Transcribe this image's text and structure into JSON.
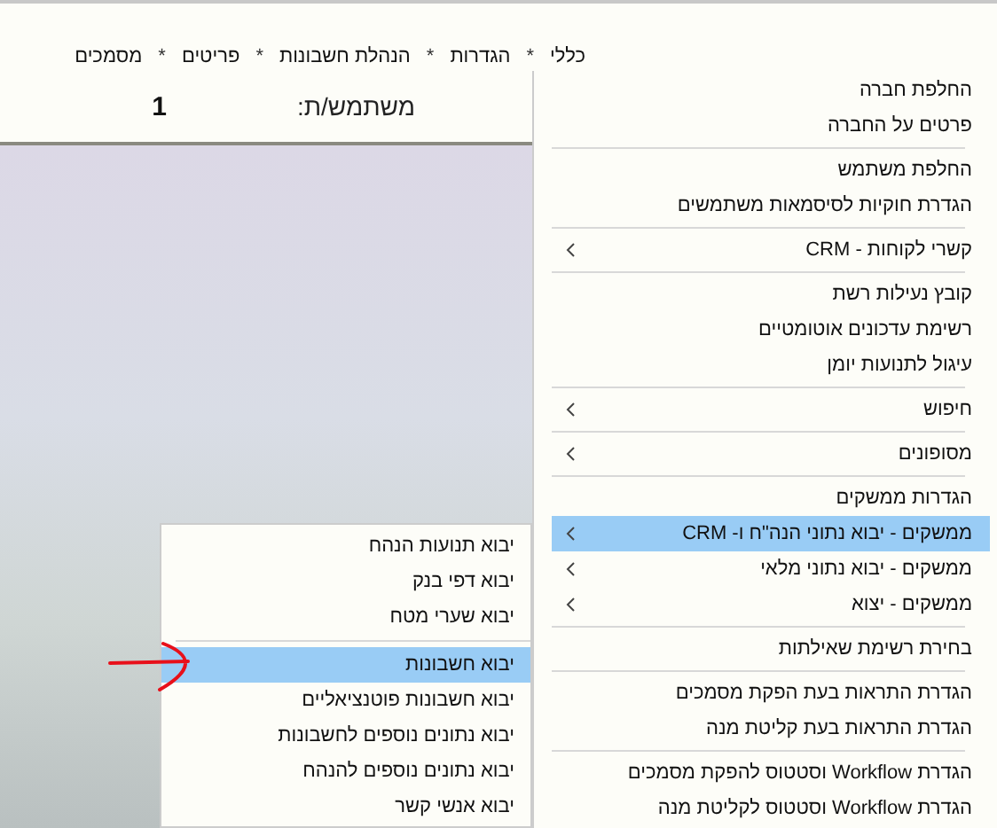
{
  "menubar": [
    {
      "label": "כללי",
      "kind": "menu"
    },
    {
      "label": "*",
      "kind": "separator"
    },
    {
      "label": "הגדרות",
      "kind": "menu"
    },
    {
      "label": "*",
      "kind": "separator"
    },
    {
      "label": "הנהלת חשבונות",
      "kind": "menu"
    },
    {
      "label": "*",
      "kind": "separator"
    },
    {
      "label": "פריטים",
      "kind": "menu"
    },
    {
      "label": "*",
      "kind": "separator"
    },
    {
      "label": "מסמכים",
      "kind": "menu"
    }
  ],
  "header": {
    "label": "משתמש/ת:",
    "value": "1"
  },
  "menu": [
    {
      "kind": "item",
      "label": "החלפת חברה",
      "submenu": false,
      "selected": false
    },
    {
      "kind": "item",
      "label": "פרטים על החברה",
      "submenu": false,
      "selected": false
    },
    {
      "kind": "separator"
    },
    {
      "kind": "item",
      "label": "החלפת משתמש",
      "submenu": false,
      "selected": false
    },
    {
      "kind": "item",
      "label": "הגדרת חוקיות לסיסמאות משתמשים",
      "submenu": false,
      "selected": false
    },
    {
      "kind": "separator"
    },
    {
      "kind": "item",
      "label": "קשרי לקוחות - CRM",
      "submenu": true,
      "selected": false
    },
    {
      "kind": "separator"
    },
    {
      "kind": "item",
      "label": "קובץ נעילות רשת",
      "submenu": false,
      "selected": false
    },
    {
      "kind": "item",
      "label": "רשימת עדכונים אוטומטיים",
      "submenu": false,
      "selected": false
    },
    {
      "kind": "item",
      "label": "עיגול לתנועות יומן",
      "submenu": false,
      "selected": false
    },
    {
      "kind": "separator"
    },
    {
      "kind": "item",
      "label": "חיפוש",
      "submenu": true,
      "selected": false
    },
    {
      "kind": "separator"
    },
    {
      "kind": "item",
      "label": "מסופונים",
      "submenu": true,
      "selected": false
    },
    {
      "kind": "separator"
    },
    {
      "kind": "item",
      "label": "הגדרות ממשקים",
      "submenu": false,
      "selected": false
    },
    {
      "kind": "item",
      "label": "ממשקים - יבוא נתוני הנה\"ח ו- CRM",
      "submenu": true,
      "selected": true
    },
    {
      "kind": "item",
      "label": "ממשקים - יבוא נתוני מלאי",
      "submenu": true,
      "selected": false
    },
    {
      "kind": "item",
      "label": "ממשקים - יצוא",
      "submenu": true,
      "selected": false
    },
    {
      "kind": "separator"
    },
    {
      "kind": "item",
      "label": "בחירת רשימת שאילתות",
      "submenu": false,
      "selected": false
    },
    {
      "kind": "separator"
    },
    {
      "kind": "item",
      "label": "הגדרת התראות בעת הפקת מסמכים",
      "submenu": false,
      "selected": false
    },
    {
      "kind": "item",
      "label": "הגדרת התראות בעת קליטת מנה",
      "submenu": false,
      "selected": false
    },
    {
      "kind": "separator"
    },
    {
      "kind": "item",
      "label": "הגדרת Workflow וסטטוס להפקת מסמכים",
      "submenu": false,
      "selected": false
    },
    {
      "kind": "item",
      "label": "הגדרת Workflow וסטטוס לקליטת מנה",
      "submenu": false,
      "selected": false
    }
  ],
  "submenu": [
    {
      "kind": "item",
      "label": "יבוא תנועות הנהח",
      "selected": false
    },
    {
      "kind": "item",
      "label": "יבוא דפי בנק",
      "selected": false
    },
    {
      "kind": "item",
      "label": "יבוא שערי מטח",
      "selected": false
    },
    {
      "kind": "separator"
    },
    {
      "kind": "item",
      "label": "יבוא חשבונות",
      "selected": true
    },
    {
      "kind": "item",
      "label": "יבוא חשבונות פוטנציאליים",
      "selected": false
    },
    {
      "kind": "item",
      "label": "יבוא נתונים נוספים לחשבונות",
      "selected": false
    },
    {
      "kind": "item",
      "label": "יבוא נתונים נוספים להנהח",
      "selected": false
    },
    {
      "kind": "item",
      "label": "יבוא אנשי קשר",
      "selected": false
    }
  ]
}
